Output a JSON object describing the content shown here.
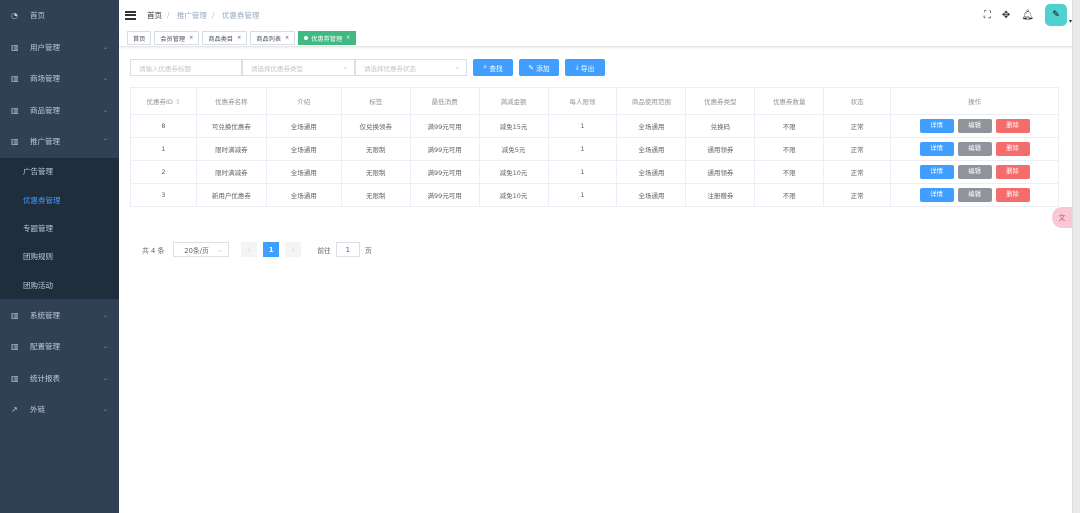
{
  "sidebar": {
    "items": [
      {
        "label": "首页",
        "icon": "dashboard-icon",
        "expandable": false
      },
      {
        "label": "用户管理",
        "icon": "chart-icon",
        "expandable": true
      },
      {
        "label": "商场管理",
        "icon": "chart-icon",
        "expandable": true
      },
      {
        "label": "商品管理",
        "icon": "chart-icon",
        "expandable": true
      },
      {
        "label": "推广管理",
        "icon": "chart-icon",
        "expandable": true,
        "expanded": true
      }
    ],
    "submenu": [
      "广告管理",
      "优惠券管理",
      "专题管理",
      "团购规则",
      "团购活动"
    ],
    "items_after": [
      {
        "label": "系统管理",
        "icon": "chart-icon"
      },
      {
        "label": "配置管理",
        "icon": "chart-icon"
      },
      {
        "label": "统计报表",
        "icon": "chart-icon"
      },
      {
        "label": "外链",
        "icon": "external-link-icon"
      }
    ]
  },
  "breadcrumb": [
    "首页",
    "推广管理",
    "优惠券管理"
  ],
  "tags": [
    {
      "label": "首页"
    },
    {
      "label": "会员管理"
    },
    {
      "label": "商品类目"
    },
    {
      "label": "商品列表"
    },
    {
      "label": "优惠券管理",
      "active": true
    }
  ],
  "search": {
    "title_placeholder": "请输入优惠券标题",
    "type_placeholder": "请选择优惠券类型",
    "status_placeholder": "请选择优惠券状态",
    "find": "查找",
    "add": "添加",
    "export": "导出"
  },
  "table": {
    "headers": [
      "优惠券ID",
      "优惠券名称",
      "介绍",
      "标签",
      "最低消费",
      "满减金额",
      "每人限领",
      "商品使用范围",
      "优惠券类型",
      "优惠券数量",
      "状态",
      "操作"
    ],
    "rows": [
      [
        "8",
        "可兑换优惠券",
        "全场通用",
        "仅兑换领券",
        "满99元可用",
        "减免15元",
        "1",
        "全场通用",
        "兑换码",
        "不限",
        "正常"
      ],
      [
        "1",
        "限时满减券",
        "全场通用",
        "无限制",
        "满99元可用",
        "减免5元",
        "1",
        "全场通用",
        "通用领券",
        "不限",
        "正常"
      ],
      [
        "2",
        "限时满减券",
        "全场通用",
        "无限制",
        "满99元可用",
        "减免10元",
        "1",
        "全场通用",
        "通用领券",
        "不限",
        "正常"
      ],
      [
        "3",
        "新用户优惠券",
        "全场通用",
        "无限制",
        "满99元可用",
        "减免10元",
        "1",
        "全场通用",
        "注册赠券",
        "不限",
        "正常"
      ]
    ],
    "actions": {
      "detail": "详情",
      "edit": "编辑",
      "delete": "删除"
    }
  },
  "pagination": {
    "total": "共 4 条",
    "page_size": "20条/页",
    "current": "1",
    "goto_label": "前往",
    "goto_value": "1",
    "page_suffix": "页"
  },
  "colors": {
    "sidebar": "#304156",
    "primary": "#409eff",
    "success": "#42b983",
    "danger": "#f56c6c"
  }
}
